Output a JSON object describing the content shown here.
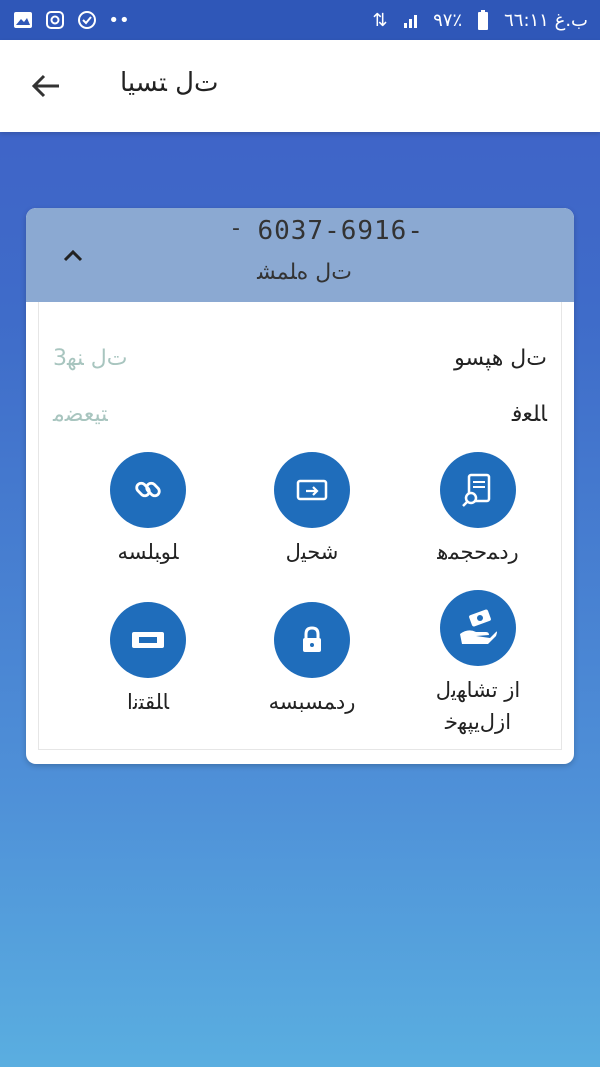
{
  "status_bar": {
    "time": "ب.غ ٦٦:١١",
    "battery": "٩٧٪",
    "icons": [
      "gallery-icon",
      "instagram-icon",
      "whatsapp-icon",
      "more-dots-icon",
      "battery-icon",
      "signal-icon",
      "data-icon"
    ]
  },
  "app_bar": {
    "title": "ت‌ﻝ ﺘﺴﻴﺎ"
  },
  "card": {
    "number": "6037-6916-",
    "dash": "-",
    "label": "ت‌ﻝ ﻩ‌ﻠﻤﺸ",
    "info": [
      {
        "label": "ت‌ﻝ ﻫﭙﺴﻮ",
        "value": "ت‌ﻝ ﻨﻬ3"
      },
      {
        "label": "ﺎﻠﻌﻓ",
        "value": "ﺘﯿﻌﻀﻣ"
      }
    ],
    "actions": [
      {
        "label": "ﺭﺩﻤﺣﺠﻤﻫ",
        "icon": "receipt-search-icon"
      },
      {
        "label": "ﺷﺤﻴ‌ﻝ",
        "icon": "transfer-icon"
      },
      {
        "label": "ﻠﻮﺒﻠﺴﻪ",
        "icon": "link-icon"
      },
      {
        "label": "ﺍﺯ ﺗﺸﺎﻬﻳ‌ﻝ",
        "label2": "ﺍﺯﻝﻳﭙﻬﺧ",
        "icon": "money-hand-icon"
      },
      {
        "label": "ﺭﺩﻤﺴﺒﺴﻪ",
        "icon": "lock-icon"
      },
      {
        "label": "ﺎﻠﻘﺘﻧﺍ",
        "icon": "card-transfer-icon"
      }
    ]
  },
  "colors": {
    "accent": "#1f6dbb",
    "header": "#8ba9d2",
    "status_bar": "#2f57b8"
  }
}
